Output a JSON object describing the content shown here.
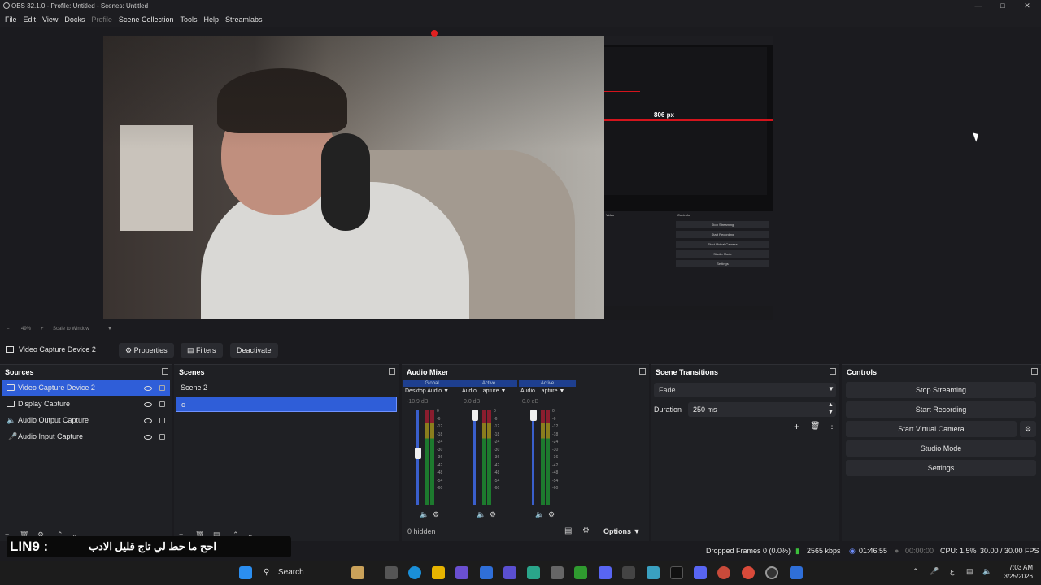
{
  "window": {
    "title": "OBS 32.1.0 - Profile: Untitled - Scenes: Untitled"
  },
  "menu": [
    "File",
    "Edit",
    "View",
    "Docks",
    "Profile",
    "Scene Collection",
    "Tools",
    "Help",
    "Streamlabs"
  ],
  "preview": {
    "measure_label": "806 px",
    "zoom": "49%",
    "scale_label": "Scale to Window",
    "mini_controls": [
      "Stop Streaming",
      "Start Recording",
      "Start Virtual Camera",
      "Studio Mode",
      "Settings"
    ],
    "mini_sources_title": "Video",
    "mini_controls_title": "Controls"
  },
  "context_bar": {
    "source_name": "Video Capture Device 2",
    "properties": "Properties",
    "filters": "Filters",
    "deactivate": "Deactivate"
  },
  "sources": {
    "title": "Sources",
    "items": [
      {
        "label": "Video Capture Device 2",
        "icon": "camera-icon",
        "selected": true
      },
      {
        "label": "Display Capture",
        "icon": "monitor-icon",
        "selected": false
      },
      {
        "label": "Audio Output Capture",
        "icon": "speaker-icon",
        "selected": false
      },
      {
        "label": "Audio Input Capture",
        "icon": "microphone-icon",
        "selected": false
      }
    ]
  },
  "scenes": {
    "title": "Scenes",
    "items": [
      {
        "label": "Scene 2",
        "selected": false
      },
      {
        "label": "c",
        "selected": true
      }
    ]
  },
  "audio_mixer": {
    "title": "Audio Mixer",
    "channels": [
      {
        "header": "Global",
        "name": "Desktop Audio",
        "db": "-10.9 dB",
        "fader_level": 0.55
      },
      {
        "header": "Active",
        "name": "Audio ...apture",
        "db": "0.0 dB",
        "fader_level": 1.0
      },
      {
        "header": "Active",
        "name": "Audio ...apture",
        "db": "0.0 dB",
        "fader_level": 1.0
      }
    ],
    "ticks": [
      "0",
      "-6",
      "-12",
      "-18",
      "-24",
      "-30",
      "-36",
      "-42",
      "-48",
      "-54",
      "-60"
    ],
    "hidden_label": "0 hidden",
    "options_label": "Options"
  },
  "scene_transitions": {
    "title": "Scene Transitions",
    "transition": "Fade",
    "duration_label": "Duration",
    "duration_value": "250 ms"
  },
  "controls": {
    "title": "Controls",
    "buttons": [
      "Stop Streaming",
      "Start Recording",
      "Start Virtual Camera",
      "Studio Mode",
      "Settings"
    ]
  },
  "status": {
    "dropped_frames": "Dropped Frames 0 (0.0%)",
    "bitrate": "2565 kbps",
    "stream_time": "01:46:55",
    "record_time": "00:00:00",
    "cpu": "CPU: 1.5%",
    "fps": "30.00 / 30.00 FPS"
  },
  "overlay": {
    "brand": "LIN9 :",
    "message": "احح ما حط لي تاج قليل الادب"
  },
  "taskbar": {
    "search": "Search",
    "time": "7:03 AM",
    "date": "3/25/2026"
  },
  "colors": {
    "accent": "#2f5ed8",
    "record_red": "#d4141c"
  }
}
